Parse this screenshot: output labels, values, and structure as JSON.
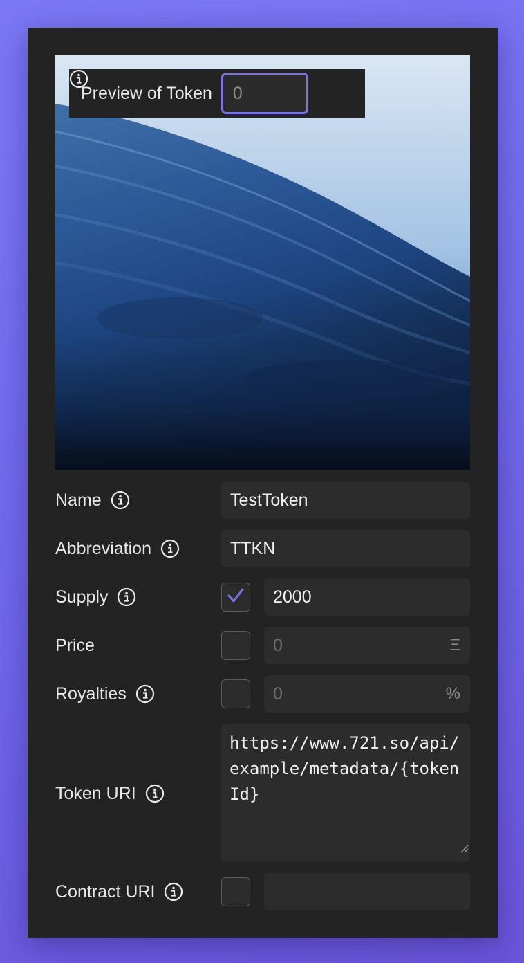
{
  "preview": {
    "label": "Preview of Token",
    "token_input_value": "0"
  },
  "form": {
    "name": {
      "label": "Name",
      "value": "TestToken"
    },
    "abbreviation": {
      "label": "Abbreviation",
      "value": "TTKN"
    },
    "supply": {
      "label": "Supply",
      "checked": true,
      "value": "2000"
    },
    "price": {
      "label": "Price",
      "checked": false,
      "placeholder": "0",
      "suffix": "Ξ"
    },
    "royalties": {
      "label": "Royalties",
      "checked": false,
      "placeholder": "0",
      "suffix": "%"
    },
    "token_uri": {
      "label": "Token URI",
      "value": "https://www.721.so/api/example/metadata/{tokenId}"
    },
    "contract_uri": {
      "label": "Contract URI",
      "checked": false,
      "value": ""
    }
  },
  "colors": {
    "accent": "#7b73e8",
    "card_background": "#232323",
    "field_background": "#2c2c2c",
    "page_background": "#7b78f5"
  },
  "icons": [
    "info-icon",
    "check-icon",
    "resize-handle-icon"
  ]
}
